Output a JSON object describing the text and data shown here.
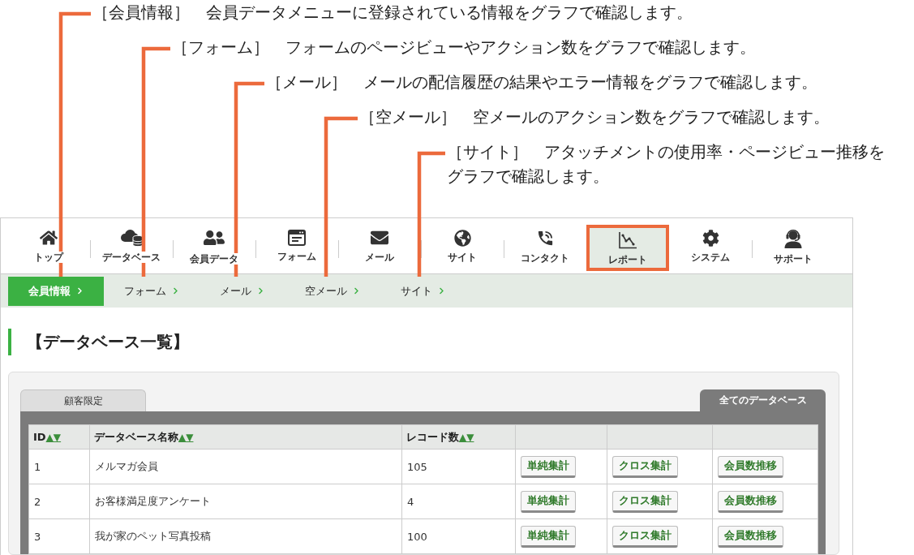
{
  "callouts": [
    {
      "text": "［会員情報］　会員データメニューに登録されている情報をグラフで確認します。"
    },
    {
      "text": "［フォーム］　フォームのページビューやアクション数をグラフで確認します。"
    },
    {
      "text": "［メール］　メールの配信履歴の結果やエラー情報をグラフで確認します。"
    },
    {
      "text": "［空メール］　空メールのアクション数をグラフで確認します。"
    },
    {
      "text": "［サイト］　アタッチメントの使用率・ページビュー推移をグラフで確認します。"
    }
  ],
  "nav": {
    "items": [
      {
        "label": "トップ",
        "selected": false,
        "highlighted": false
      },
      {
        "label": "データベース",
        "selected": false,
        "highlighted": false
      },
      {
        "label": "会員データ",
        "selected": false,
        "highlighted": false
      },
      {
        "label": "フォーム",
        "selected": false,
        "highlighted": false
      },
      {
        "label": "メール",
        "selected": false,
        "highlighted": false
      },
      {
        "label": "サイト",
        "selected": false,
        "highlighted": false
      },
      {
        "label": "コンタクト",
        "selected": false,
        "highlighted": false
      },
      {
        "label": "レポート",
        "selected": true,
        "highlighted": true
      },
      {
        "label": "システム",
        "selected": false,
        "highlighted": false
      },
      {
        "label": "サポート",
        "selected": false,
        "highlighted": false
      }
    ]
  },
  "subnav": {
    "items": [
      {
        "label": "会員情報",
        "selected": true
      },
      {
        "label": "フォーム",
        "selected": false
      },
      {
        "label": "メール",
        "selected": false
      },
      {
        "label": "空メール",
        "selected": false
      },
      {
        "label": "サイト",
        "selected": false
      }
    ]
  },
  "heading": "【データベース一覧】",
  "tabs": [
    {
      "label": "顧客限定",
      "selected": false
    },
    {
      "label": "全てのデータベース",
      "selected": true
    }
  ],
  "table": {
    "columns": [
      {
        "label": "ID",
        "sort": "▲▼"
      },
      {
        "label": "データベース名称",
        "sort": "▲▼"
      },
      {
        "label": "レコード数",
        "sort": "▲▼"
      }
    ],
    "rows": [
      {
        "id": "1",
        "name": "メルマガ会員",
        "records": "105",
        "actions": [
          "単純集計",
          "クロス集計",
          "会員数推移"
        ]
      },
      {
        "id": "2",
        "name": "お客様満足度アンケート",
        "records": "4",
        "actions": [
          "単純集計",
          "クロス集計",
          "会員数推移"
        ]
      },
      {
        "id": "3",
        "name": "我が家のペット写真投稿",
        "records": "100",
        "actions": [
          "単純集計",
          "クロス集計",
          "会員数推移"
        ]
      }
    ]
  }
}
